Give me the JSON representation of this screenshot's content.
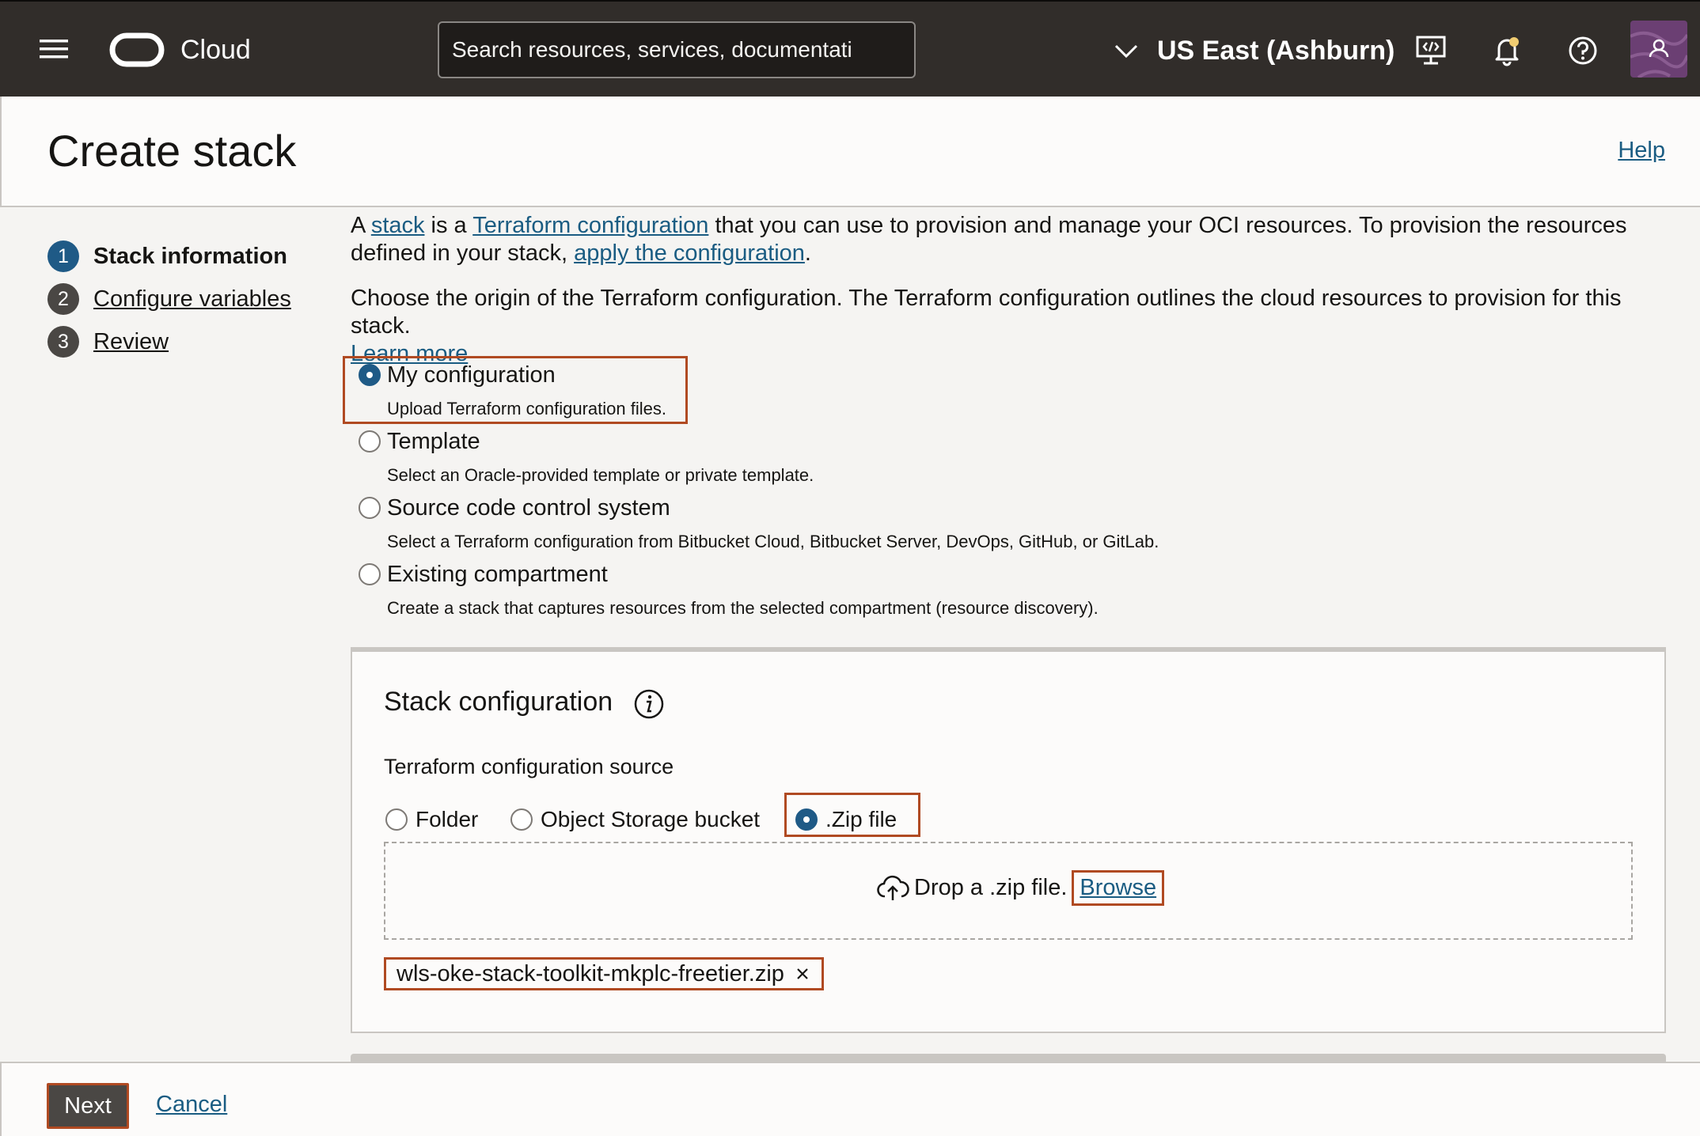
{
  "header": {
    "menu_icon": "hamburger-menu-icon",
    "brand_logo": "oracle-logo-icon",
    "brand": "Cloud",
    "search_placeholder": "Search resources, services, documentati",
    "region": "US East (Ashburn)",
    "icons": [
      "developer-tools-icon",
      "notifications-bell-icon",
      "help-circle-icon",
      "user-avatar-icon"
    ],
    "notification_dot_color": "#f0cc71"
  },
  "page": {
    "title": "Create stack",
    "help_label": "Help"
  },
  "steps": [
    {
      "number": "1",
      "label": "Stack information",
      "active": true
    },
    {
      "number": "2",
      "label": "Configure variables",
      "active": false
    },
    {
      "number": "3",
      "label": "Review",
      "active": false
    }
  ],
  "intro": {
    "p1_a": "A ",
    "p1_link1": "stack",
    "p1_b": " is a ",
    "p1_link2": "Terraform configuration",
    "p1_c": " that you can use to provision and manage your OCI resources. To provision the resources defined in your stack, ",
    "p1_link3": "apply the configuration",
    "p1_d": ".",
    "p2": "Choose the origin of the Terraform configuration. The Terraform configuration outlines the cloud resources to provision for this stack.",
    "p2_link": "Learn more"
  },
  "origin_options": [
    {
      "title": "My configuration",
      "desc": "Upload Terraform configuration files.",
      "checked": true
    },
    {
      "title": "Template",
      "desc": "Select an Oracle-provided template or private template.",
      "checked": false
    },
    {
      "title": "Source code control system",
      "desc": "Select a Terraform configuration from Bitbucket Cloud, Bitbucket Server, DevOps, GitHub, or GitLab.",
      "checked": false
    },
    {
      "title": "Existing compartment",
      "desc": "Create a stack that captures resources from the selected compartment (resource discovery).",
      "checked": false
    }
  ],
  "stack_config": {
    "title": "Stack configuration",
    "info_icon": "info-icon",
    "source_label": "Terraform configuration source",
    "sources": [
      {
        "label": "Folder",
        "checked": false
      },
      {
        "label": "Object Storage bucket",
        "checked": false
      },
      {
        "label": ".Zip file",
        "checked": true
      }
    ],
    "drop_text": "Drop a .zip file.",
    "browse_label": "Browse",
    "file_name": "wls-oke-stack-toolkit-mkplc-freetier.zip"
  },
  "footer": {
    "next_label": "Next",
    "cancel_label": "Cancel"
  },
  "colors": {
    "header_bg": "#312d2a",
    "link": "#1a5c82",
    "active_step": "#1f5a86",
    "highlight_box": "#b04a22",
    "button_bg": "#4a4744"
  }
}
